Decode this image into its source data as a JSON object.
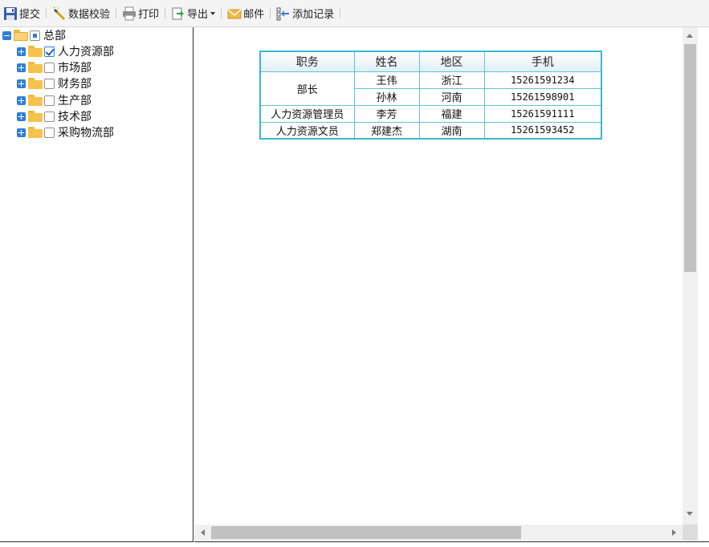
{
  "toolbar": {
    "buttons": [
      {
        "label": "提交",
        "icon": "save-icon"
      },
      {
        "label": "数据校验",
        "icon": "wand-icon"
      },
      {
        "label": "打印",
        "icon": "printer-icon"
      },
      {
        "label": "导出",
        "icon": "export-icon"
      },
      {
        "label": "邮件",
        "icon": "mail-icon"
      },
      {
        "label": "添加记录",
        "icon": "add-record-icon"
      }
    ]
  },
  "tree": {
    "root": {
      "label": "总部",
      "expanded": true,
      "check": "partial"
    },
    "children": [
      {
        "label": "人力资源部",
        "checked": true
      },
      {
        "label": "市场部",
        "checked": false
      },
      {
        "label": "财务部",
        "checked": false
      },
      {
        "label": "生产部",
        "checked": false
      },
      {
        "label": "技术部",
        "checked": false
      },
      {
        "label": "采购物流部",
        "checked": false
      }
    ]
  },
  "table": {
    "headers": [
      "职务",
      "姓名",
      "地区",
      "手机"
    ],
    "rows": [
      {
        "position": "部长",
        "name": "王伟",
        "region": "浙江",
        "phone": "15261591234"
      },
      {
        "position": "",
        "name": "孙林",
        "region": "河南",
        "phone": "15261598901"
      },
      {
        "position": "人力资源管理员",
        "name": "李芳",
        "region": "福建",
        "phone": "15261591111"
      },
      {
        "position": "人力资源文员",
        "name": "郑建杰",
        "region": "湖南",
        "phone": "15261593452"
      }
    ]
  },
  "colors": {
    "accent": "#2f7fd8",
    "table_border": "#5fc3d9",
    "folder": "#f6c24b"
  }
}
